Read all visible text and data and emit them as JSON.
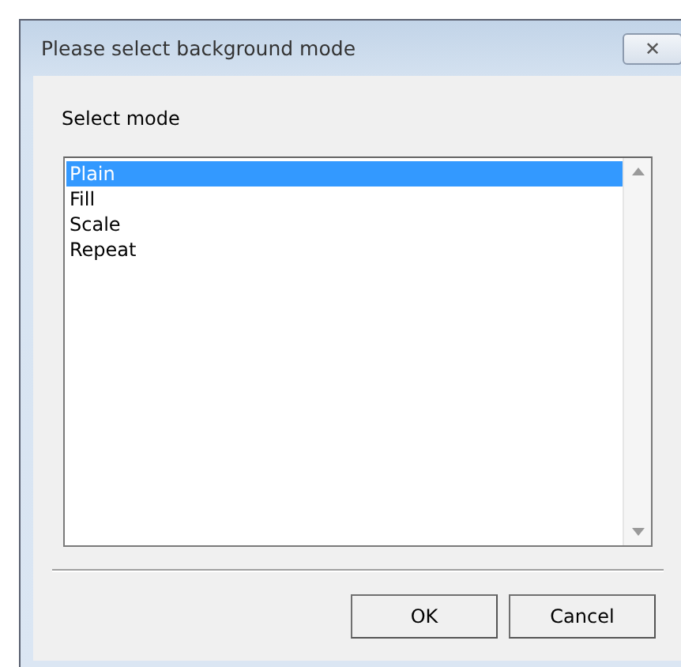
{
  "window": {
    "title": "Please select background mode",
    "close_label": "✕"
  },
  "label": "Select mode",
  "list": {
    "items": [
      {
        "label": "Plain",
        "selected": true
      },
      {
        "label": "Fill",
        "selected": false
      },
      {
        "label": "Scale",
        "selected": false
      },
      {
        "label": "Repeat",
        "selected": false
      }
    ]
  },
  "buttons": [
    "OK",
    "Cancel"
  ]
}
